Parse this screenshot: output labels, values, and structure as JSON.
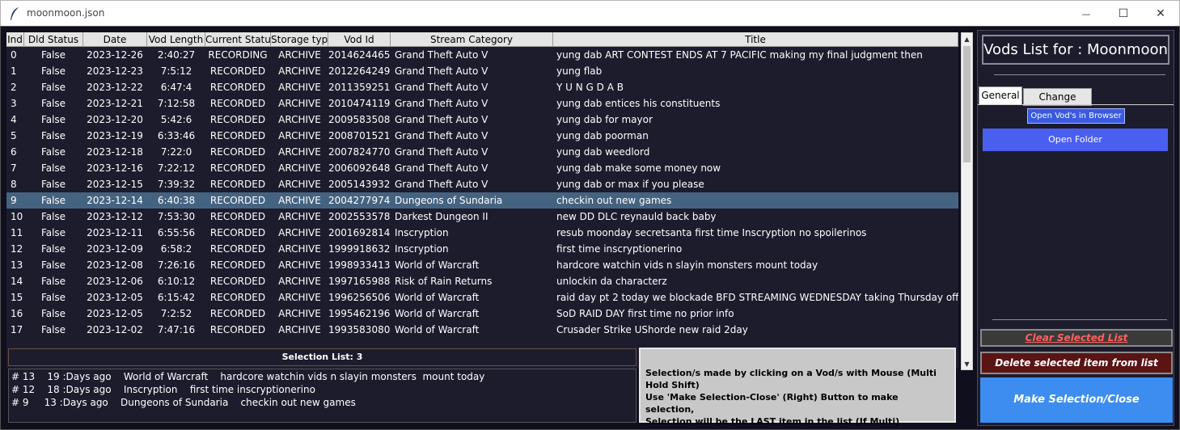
{
  "window": {
    "title": "moonmoon.json",
    "minimize_glyph": "—",
    "maximize_glyph": "☐",
    "close_glyph": "✕",
    "app_icon": "feather-icon"
  },
  "table": {
    "columns": [
      "Ind",
      "Dld Status",
      "Date",
      "Vod Length",
      "Current Status",
      "Storage type",
      "Vod Id",
      "Stream Category",
      "Title"
    ],
    "selected_row_index": 9,
    "rows": [
      [
        "0",
        "False",
        "2023-12-26",
        "2:40:27",
        "RECORDING",
        "ARCHIVE",
        "2014624465",
        "Grand Theft Auto V",
        "yung dab  ART CONTEST ENDS AT 7 PACIFIC  making my final judgment then"
      ],
      [
        "1",
        "False",
        "2023-12-23",
        "7:5:12",
        "RECORDED",
        "ARCHIVE",
        "2012264249",
        "Grand Theft Auto V",
        "yung flab"
      ],
      [
        "2",
        "False",
        "2023-12-22",
        "6:47:4",
        "RECORDED",
        "ARCHIVE",
        "2011359251",
        "Grand Theft Auto V",
        "Y U N G   D A B"
      ],
      [
        "3",
        "False",
        "2023-12-21",
        "7:12:58",
        "RECORDED",
        "ARCHIVE",
        "2010474119",
        "Grand Theft Auto V",
        "yung dab entices his constituents"
      ],
      [
        "4",
        "False",
        "2023-12-20",
        "5:42:6",
        "RECORDED",
        "ARCHIVE",
        "2009583508",
        "Grand Theft Auto V",
        "yung dab for mayor"
      ],
      [
        "5",
        "False",
        "2023-12-19",
        "6:33:46",
        "RECORDED",
        "ARCHIVE",
        "2008701521",
        "Grand Theft Auto V",
        "yung dab poorman"
      ],
      [
        "6",
        "False",
        "2023-12-18",
        "7:22:0",
        "RECORDED",
        "ARCHIVE",
        "2007824770",
        "Grand Theft Auto V",
        "yung dab weedlord"
      ],
      [
        "7",
        "False",
        "2023-12-16",
        "7:22:12",
        "RECORDED",
        "ARCHIVE",
        "2006092648",
        "Grand Theft Auto V",
        "yung dab make some money now"
      ],
      [
        "8",
        "False",
        "2023-12-15",
        "7:39:32",
        "RECORDED",
        "ARCHIVE",
        "2005143932",
        "Grand Theft Auto V",
        "yung dab or max if you please"
      ],
      [
        "9",
        "False",
        "2023-12-14",
        "6:40:38",
        "RECORDED",
        "ARCHIVE",
        "2004277974",
        "Dungeons of Sundaria",
        "checkin out new games"
      ],
      [
        "10",
        "False",
        "2023-12-12",
        "7:53:30",
        "RECORDED",
        "ARCHIVE",
        "2002553578",
        "Darkest Dungeon II",
        "new DD DLC  reynauld back baby"
      ],
      [
        "11",
        "False",
        "2023-12-11",
        "6:55:56",
        "RECORDED",
        "ARCHIVE",
        "2001692814",
        "Inscryption",
        "resub moonday  secretsanta  first time Inscryption no spoilerinos"
      ],
      [
        "12",
        "False",
        "2023-12-09",
        "6:58:2",
        "RECORDED",
        "ARCHIVE",
        "1999918632",
        "Inscryption",
        "first time inscryptionerino"
      ],
      [
        "13",
        "False",
        "2023-12-08",
        "7:26:16",
        "RECORDED",
        "ARCHIVE",
        "1998933413",
        "World of Warcraft",
        "hardcore watchin vids n slayin monsters  mount today"
      ],
      [
        "14",
        "False",
        "2023-12-06",
        "6:10:12",
        "RECORDED",
        "ARCHIVE",
        "1997165988",
        "Risk of Rain Returns",
        "unlockin da characterz"
      ],
      [
        "15",
        "False",
        "2023-12-05",
        "6:15:42",
        "RECORDED",
        "ARCHIVE",
        "1996256506",
        "World of Warcraft",
        "raid day pt 2  today we blockade BFD  STREAMING WEDNESDAY taking Thursday off"
      ],
      [
        "16",
        "False",
        "2023-12-05",
        "7:2:52",
        "RECORDED",
        "ARCHIVE",
        "1995462196",
        "World of Warcraft",
        "SoD RAID DAY first time no prior info"
      ],
      [
        "17",
        "False",
        "2023-12-02",
        "7:47:16",
        "RECORDED",
        "ARCHIVE",
        "1993583080",
        "World of Warcraft",
        "Crusader Strike UShorde  new raid 2day"
      ]
    ]
  },
  "selection": {
    "header": "Selection List: 3",
    "items": [
      "# 13    19 :Days ago    World of Warcraft    hardcore watchin vids n slayin monsters  mount today",
      "# 12    18 :Days ago    Inscryption    first time inscryptionerino",
      "# 9     13 :Days ago    Dungeons of Sundaria    checkin out new games"
    ]
  },
  "info": {
    "line1": "Selection/s made by clicking on a Vod/s with Mouse (Multi Hold Shift)",
    "line2": "Use 'Make Selection-Close' (Right) Button to make selection,",
    "line3": "Selection will be the LAST item in the list (If Multi)"
  },
  "panel": {
    "title": "Vods List for : Moonmoon",
    "tabs": [
      "General",
      "Change Status"
    ],
    "open_browser": "Open Vod's in Browser",
    "open_folder": "Open Folder",
    "clear": "Clear Selected List",
    "delete": "Delete selected item from list",
    "make": "Make Selection/Close"
  },
  "colors": {
    "frame_bg": "#0f0f1e",
    "list_bg": "#1c1c2d",
    "selected_row": "#446380",
    "open_folder_btn": "#4a5ff0",
    "clear_text": "#ff6060",
    "delete_btn": "#5a1414",
    "make_btn": "#3d8cf0"
  }
}
